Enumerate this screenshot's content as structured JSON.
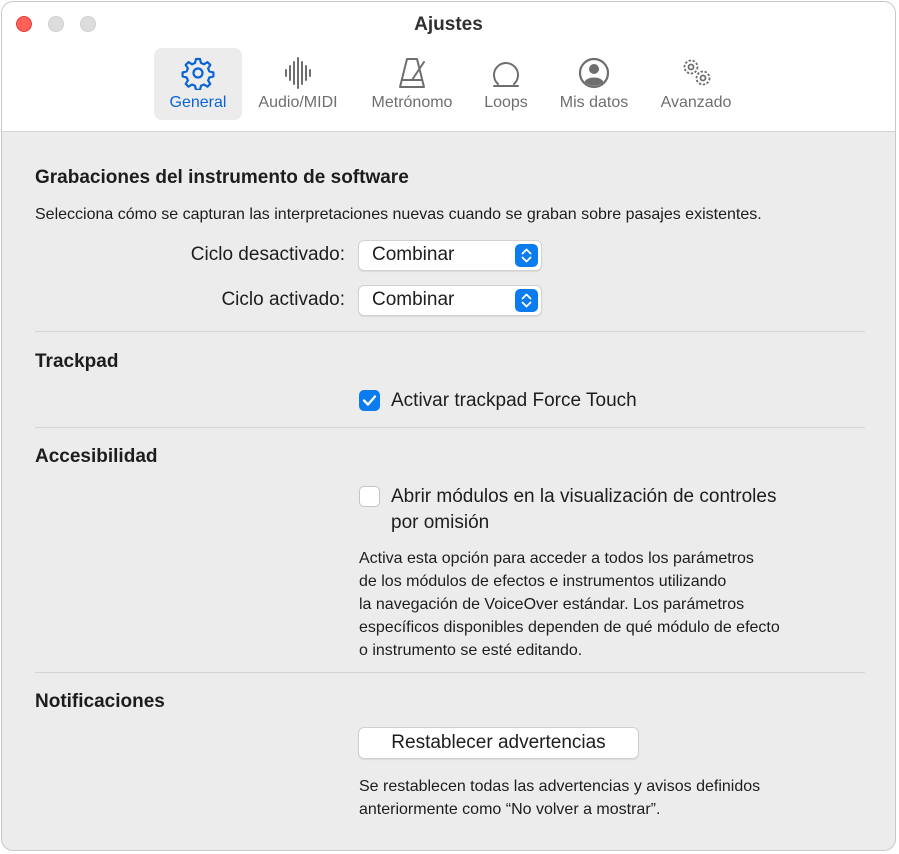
{
  "window": {
    "title": "Ajustes"
  },
  "tabs": [
    {
      "label": "General",
      "icon": "gear-icon",
      "selected": true
    },
    {
      "label": "Audio/MIDI",
      "icon": "waveform-icon",
      "selected": false
    },
    {
      "label": "Metrónomo",
      "icon": "metronome-icon",
      "selected": false
    },
    {
      "label": "Loops",
      "icon": "loop-icon",
      "selected": false
    },
    {
      "label": "Mis datos",
      "icon": "person-circle-icon",
      "selected": false
    },
    {
      "label": "Avanzado",
      "icon": "gears-icon",
      "selected": false
    }
  ],
  "recording": {
    "title": "Grabaciones del instrumento de software",
    "description": "Selecciona cómo se capturan las interpretaciones nuevas cuando se graban sobre pasajes existentes.",
    "cycle_off_label": "Ciclo desactivado:",
    "cycle_off_value": "Combinar",
    "cycle_on_label": "Ciclo activado:",
    "cycle_on_value": "Combinar"
  },
  "trackpad": {
    "title": "Trackpad",
    "force_touch_label": "Activar trackpad Force Touch",
    "force_touch_checked": true
  },
  "accessibility": {
    "title": "Accesibilidad",
    "plugin_label_line1": "Abrir módulos en la visualización de controles",
    "plugin_label_line2": "por omisión",
    "plugin_checked": false,
    "help_lines": [
      "Activa esta opción para acceder a todos los parámetros",
      "de los módulos de efectos e instrumentos utilizando",
      "la navegación de VoiceOver estándar. Los parámetros",
      "específicos disponibles dependen de qué módulo de efecto",
      "o instrumento se esté editando."
    ]
  },
  "notifications": {
    "title": "Notificaciones",
    "reset_button": "Restablecer advertencias",
    "help_lines": [
      "Se restablecen todas las advertencias y avisos definidos",
      "anteriormente como “No volver a mostrar”."
    ]
  },
  "colors": {
    "accent": "#0a7cf0",
    "selected_tab_text": "#0a64d6",
    "close_button": "#fe5f57"
  }
}
